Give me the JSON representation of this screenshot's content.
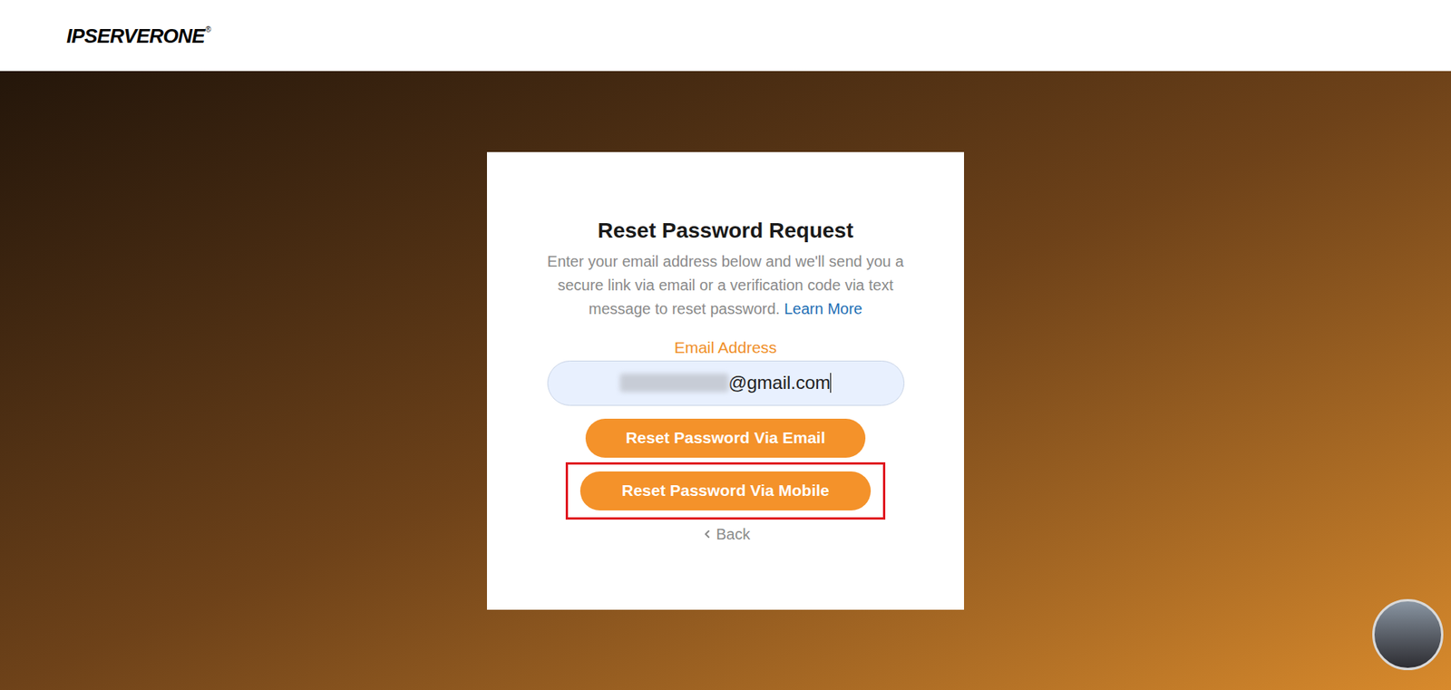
{
  "header": {
    "logo": "IPSERVERONE",
    "logo_mark": "®"
  },
  "form": {
    "title": "Reset Password Request",
    "description": "Enter your email address below and we'll send you a secure link via email or a verification code via text message to reset password.",
    "learn_more": "Learn More",
    "email_label": "Email Address",
    "email_value": "@gmail.com",
    "buttons": [
      {
        "label": "Reset Password Via Email",
        "highlighted": false
      },
      {
        "label": "Reset Password Via Mobile",
        "highlighted": true
      }
    ],
    "back": "Back"
  }
}
